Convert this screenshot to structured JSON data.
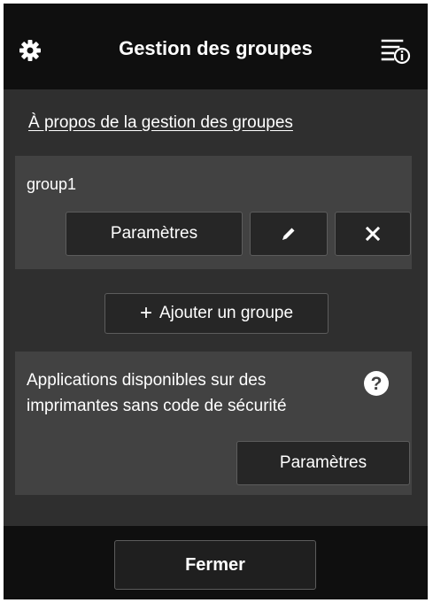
{
  "header": {
    "title": "Gestion des groupes",
    "left_icon": "gear-icon",
    "right_icon": "menu-info-icon"
  },
  "about_link": "À propos de la gestion des groupes",
  "groups": [
    {
      "name": "group1",
      "settings_label": "Paramètres",
      "edit_icon": "pencil-icon",
      "delete_icon": "close-icon"
    }
  ],
  "add_group": {
    "icon": "plus-icon",
    "label": "Ajouter un groupe"
  },
  "apps_panel": {
    "text": "Applications disponibles sur des imprimantes sans code de sécurité",
    "help_icon": "question-icon",
    "settings_label": "Paramètres"
  },
  "footer": {
    "close_label": "Fermer"
  },
  "colors": {
    "header_bg": "#0f0f0f",
    "body_bg": "#2f2f2f",
    "panel_bg": "#424242",
    "button_bg": "#262626",
    "text": "#ffffff"
  }
}
